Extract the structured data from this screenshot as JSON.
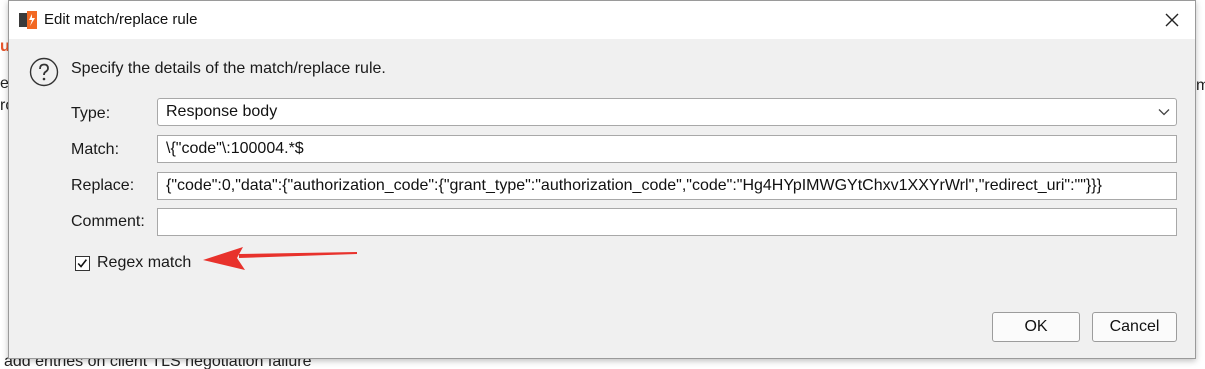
{
  "background": {
    "fragments": [
      "u",
      "e",
      "ro",
      "m"
    ],
    "bottom_text": "add entries on client TLS negotiation failure"
  },
  "dialog": {
    "title": "Edit match/replace rule",
    "intro": "Specify the details of the match/replace rule.",
    "type_label": "Type:",
    "type_value": "Response body",
    "match_label": "Match:",
    "match_value": "\\{\"code\"\\:100004.*$",
    "replace_label": "Replace:",
    "replace_value": "{\"code\":0,\"data\":{\"authorization_code\":{\"grant_type\":\"authorization_code\",\"code\":\"Hg4HYpIMWGYtChxv1XXYrWrl\",\"redirect_uri\":\"\"}}}",
    "comment_label": "Comment:",
    "comment_value": "",
    "regex_label": "Regex match",
    "regex_checked": true,
    "ok_label": "OK",
    "cancel_label": "Cancel"
  },
  "icons": {
    "app": "burp-app-icon",
    "close": "close-icon",
    "help": "question-circle-icon",
    "dropdown": "chevron-down-icon",
    "annotation": "red-arrow-annotation"
  },
  "colors": {
    "annotation_arrow": "#e8322c",
    "app_icon_orange": "#f26822",
    "app_icon_dark": "#3a3a3a"
  }
}
